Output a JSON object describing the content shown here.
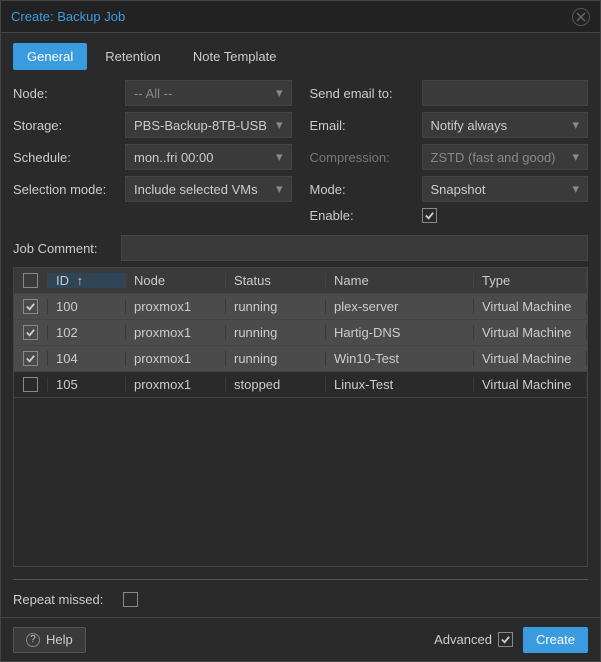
{
  "window": {
    "title": "Create: Backup Job"
  },
  "tabs": {
    "general": "General",
    "retention": "Retention",
    "note_template": "Note Template"
  },
  "form": {
    "node_label": "Node:",
    "node_value": "-- All --",
    "storage_label": "Storage:",
    "storage_value": "PBS-Backup-8TB-USB",
    "schedule_label": "Schedule:",
    "schedule_value": "mon..fri 00:00",
    "selection_label": "Selection mode:",
    "selection_value": "Include selected VMs",
    "sendto_label": "Send email to:",
    "sendto_value": "",
    "email_label": "Email:",
    "email_value": "Notify always",
    "compression_label": "Compression:",
    "compression_value": "ZSTD (fast and good)",
    "mode_label": "Mode:",
    "mode_value": "Snapshot",
    "enable_label": "Enable:"
  },
  "comment": {
    "label": "Job Comment:",
    "value": ""
  },
  "table": {
    "headers": {
      "id": "ID",
      "node": "Node",
      "status": "Status",
      "name": "Name",
      "type": "Type"
    },
    "rows": [
      {
        "id": "100",
        "node": "proxmox1",
        "status": "running",
        "name": "plex-server",
        "type": "Virtual Machine",
        "checked": true
      },
      {
        "id": "102",
        "node": "proxmox1",
        "status": "running",
        "name": "Hartig-DNS",
        "type": "Virtual Machine",
        "checked": true
      },
      {
        "id": "104",
        "node": "proxmox1",
        "status": "running",
        "name": "Win10-Test",
        "type": "Virtual Machine",
        "checked": true
      },
      {
        "id": "105",
        "node": "proxmox1",
        "status": "stopped",
        "name": "Linux-Test",
        "type": "Virtual Machine",
        "checked": false
      }
    ]
  },
  "repeat": {
    "label": "Repeat missed:"
  },
  "footer": {
    "help": "Help",
    "advanced": "Advanced",
    "create": "Create"
  }
}
